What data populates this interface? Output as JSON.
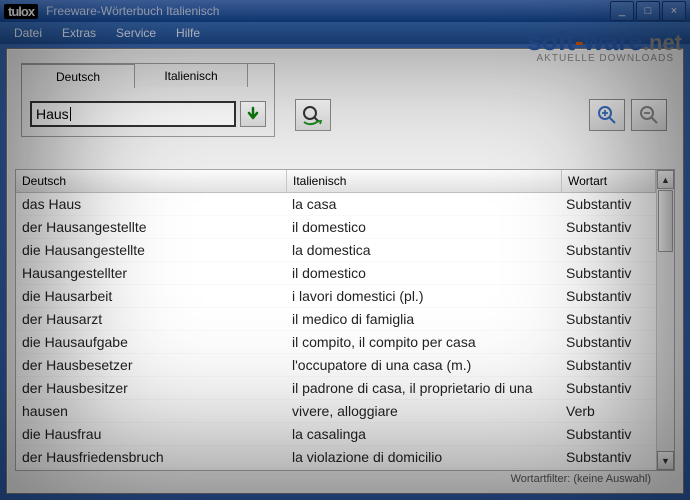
{
  "app": {
    "brand": "tulox",
    "title": "Freeware-Wörterbuch Italienisch"
  },
  "menu": {
    "file": "Datei",
    "extras": "Extras",
    "service": "Service",
    "help": "Hilfe"
  },
  "watermark": {
    "soft": "soft",
    "dash": "-",
    "ware": "ware",
    "dot": ".",
    "net": "net",
    "sub": "AKTUELLE DOWNLOADS"
  },
  "tabs": {
    "deutsch": "Deutsch",
    "italienisch": "Italienisch"
  },
  "search": {
    "value": "Haus"
  },
  "columns": {
    "c1": "Deutsch",
    "c2": "Italienisch",
    "c3": "Wortart"
  },
  "rows": [
    {
      "de": "das Haus",
      "it": "la casa",
      "wa": "Substantiv"
    },
    {
      "de": "der Hausangestellte",
      "it": "il domestico",
      "wa": "Substantiv"
    },
    {
      "de": "die Hausangestellte",
      "it": "la domestica",
      "wa": "Substantiv"
    },
    {
      "de": "Hausangestellter",
      "it": "il domestico",
      "wa": "Substantiv"
    },
    {
      "de": "die Hausarbeit",
      "it": "i lavori domestici (pl.)",
      "wa": "Substantiv"
    },
    {
      "de": "der Hausarzt",
      "it": "il medico di famiglia",
      "wa": "Substantiv"
    },
    {
      "de": "die Hausaufgabe",
      "it": "il compito, il compito per casa",
      "wa": "Substantiv"
    },
    {
      "de": "der Hausbesetzer",
      "it": "l'occupatore di una casa (m.)",
      "wa": "Substantiv"
    },
    {
      "de": "der Hausbesitzer",
      "it": "il padrone di casa, il proprietario di una",
      "wa": "Substantiv"
    },
    {
      "de": "hausen",
      "it": "vivere, alloggiare",
      "wa": "Verb"
    },
    {
      "de": "die Hausfrau",
      "it": "la casalinga",
      "wa": "Substantiv"
    },
    {
      "de": "der Hausfriedensbruch",
      "it": "la violazione di domicilio",
      "wa": "Substantiv"
    }
  ],
  "status": {
    "filter": "Wortartfilter: (keine Auswahl)"
  },
  "icons": {
    "minimize": "_",
    "maximize": "□",
    "close": "×",
    "scroll_up": "▲",
    "scroll_down": "▼"
  }
}
